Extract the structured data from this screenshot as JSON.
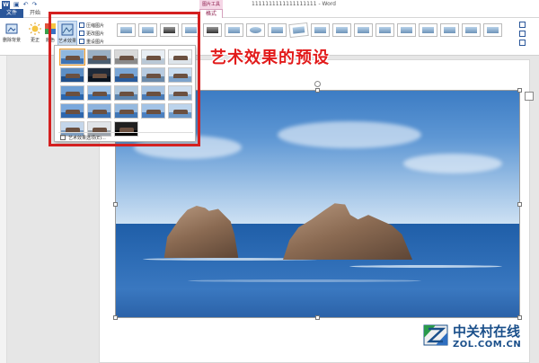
{
  "window": {
    "title": "1111111111111111111 - Word",
    "qat_icons": [
      "word-icon",
      "save-icon",
      "undo-icon",
      "redo-icon"
    ],
    "word_letter": "W"
  },
  "context_tab_group": "图片工具",
  "tabs": [
    {
      "label": "文件"
    },
    {
      "label": "开始"
    },
    {
      "label": "格式"
    }
  ],
  "ribbon": {
    "buttons": [
      {
        "label": "删除背景",
        "icon": "remove-background-icon"
      },
      {
        "label": "更正",
        "icon": "corrections-icon"
      },
      {
        "label": "颜色",
        "icon": "color-icon"
      },
      {
        "label": "艺术效果",
        "icon": "artistic-effects-icon"
      }
    ],
    "small_commands": [
      {
        "label": "压缩图片",
        "icon": "compress-icon"
      },
      {
        "label": "更改图片",
        "icon": "change-picture-icon"
      },
      {
        "label": "重设图片",
        "icon": "reset-picture-icon"
      }
    ],
    "picture_styles": [
      "style-1",
      "style-2",
      "style-3",
      "style-4",
      "style-5",
      "style-6",
      "style-7",
      "style-8",
      "style-9",
      "style-10",
      "style-11",
      "style-12",
      "style-13",
      "style-14",
      "style-15",
      "style-16",
      "style-17",
      "style-18"
    ]
  },
  "art_effects_menu": {
    "effects_count": 23,
    "options_label": "艺术效果选项(E)..."
  },
  "annotation": {
    "text": "艺术效果的预设",
    "color": "#e21b1b"
  },
  "watermark": {
    "cn": "中关村在线",
    "en": "ZOL.COM.CN"
  },
  "colors": {
    "accent": "#2b579a",
    "picture_tools": "#8b1a4a",
    "highlight_box": "#d42020"
  }
}
